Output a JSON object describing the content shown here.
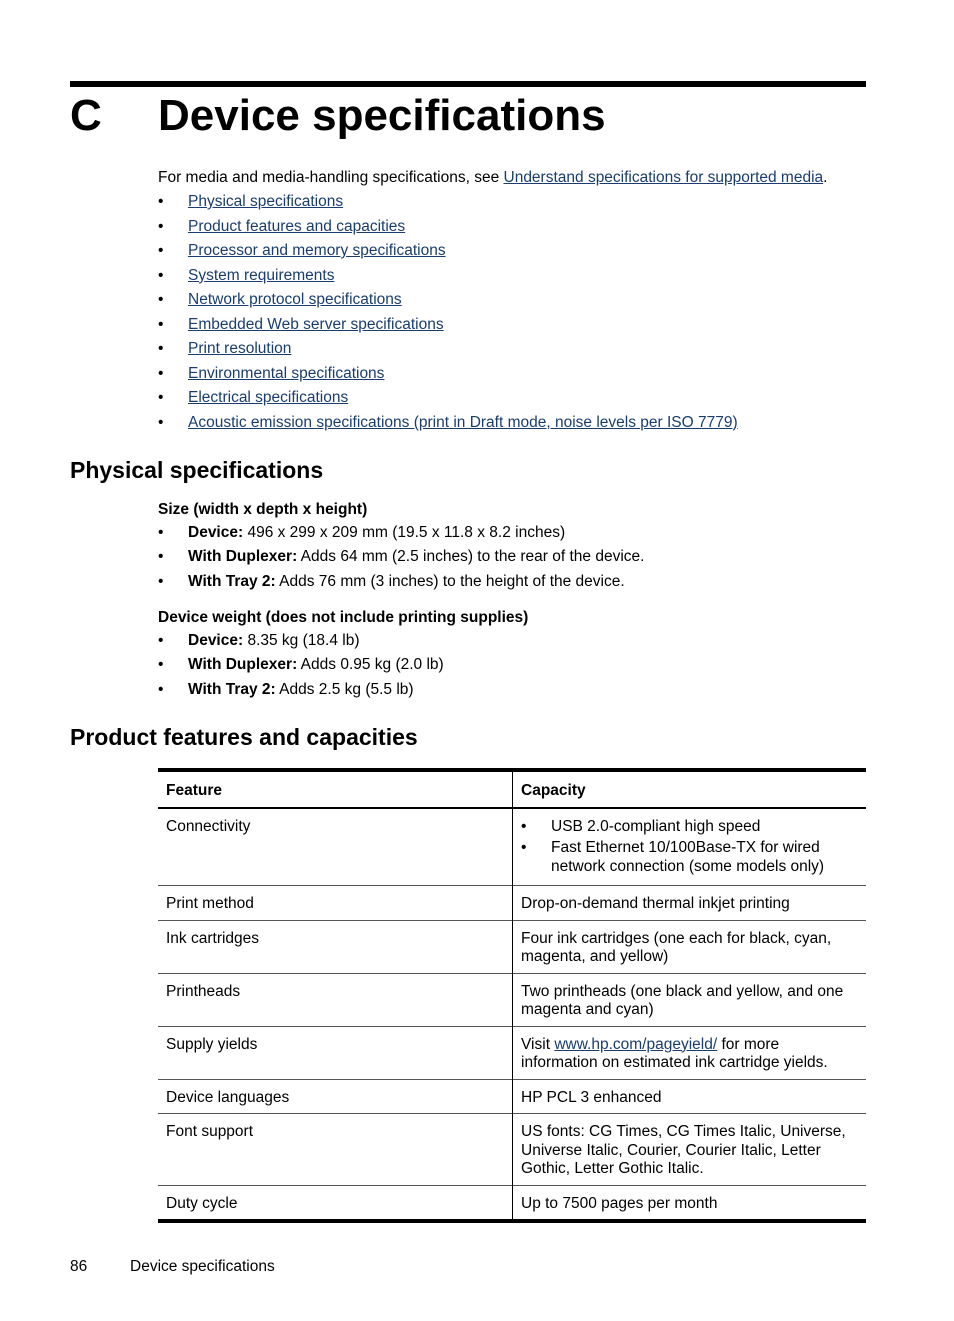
{
  "chapter": {
    "letter": "C",
    "title": "Device specifications"
  },
  "intro": {
    "text": "For media and media-handling specifications, see ",
    "link": "Understand specifications for supported media",
    "after": "."
  },
  "toc": [
    "Physical specifications",
    "Product features and capacities",
    "Processor and memory specifications",
    "System requirements",
    "Network protocol specifications",
    "Embedded Web server specifications",
    "Print resolution",
    "Environmental specifications",
    "Electrical specifications",
    "Acoustic emission specifications (print in Draft mode, noise levels per ISO 7779)"
  ],
  "bullet": "•",
  "physical": {
    "heading": "Physical specifications",
    "size": {
      "heading": "Size (width x depth x height)",
      "items": [
        {
          "label": "Device:",
          "text": " 496 x 299 x 209 mm (19.5 x 11.8 x 8.2 inches)"
        },
        {
          "label": "With Duplexer:",
          "text": " Adds 64 mm (2.5 inches) to the rear of the device."
        },
        {
          "label": "With Tray 2:",
          "text": " Adds 76 mm (3 inches) to the height of the device."
        }
      ]
    },
    "weight": {
      "heading": "Device weight (does not include printing supplies)",
      "items": [
        {
          "label": "Device:",
          "text": " 8.35 kg (18.4 lb)"
        },
        {
          "label": "With Duplexer:",
          "text": " Adds 0.95 kg (2.0 lb)"
        },
        {
          "label": "With Tray 2:",
          "text": " Adds 2.5 kg (5.5 lb)"
        }
      ]
    }
  },
  "features": {
    "heading": "Product features and capacities",
    "columns": [
      "Feature",
      "Capacity"
    ],
    "rows": [
      {
        "feature": "Connectivity",
        "capacity_list": [
          "USB 2.0-compliant high speed",
          "Fast Ethernet 10/100Base-TX for wired network connection (some models only)"
        ]
      },
      {
        "feature": "Print method",
        "capacity": "Drop-on-demand thermal inkjet printing"
      },
      {
        "feature": "Ink cartridges",
        "capacity": "Four ink cartridges (one each for black, cyan, magenta, and yellow)"
      },
      {
        "feature": "Printheads",
        "capacity": "Two printheads (one black and yellow, and one magenta and cyan)"
      },
      {
        "feature": "Supply yields",
        "capacity_before": "Visit ",
        "capacity_link": "www.hp.com/pageyield/",
        "capacity_after": " for more information on estimated ink cartridge yields."
      },
      {
        "feature": "Device languages",
        "capacity": "HP PCL 3 enhanced"
      },
      {
        "feature": "Font support",
        "capacity": "US fonts: CG Times, CG Times Italic, Universe, Universe Italic, Courier, Courier Italic, Letter Gothic, Letter Gothic Italic."
      },
      {
        "feature": "Duty cycle",
        "capacity": "Up to 7500 pages per month"
      }
    ]
  },
  "footer": {
    "page": "86",
    "section": "Device specifications"
  },
  "colors": {
    "link": "#1a3d6e",
    "text": "#000000"
  }
}
